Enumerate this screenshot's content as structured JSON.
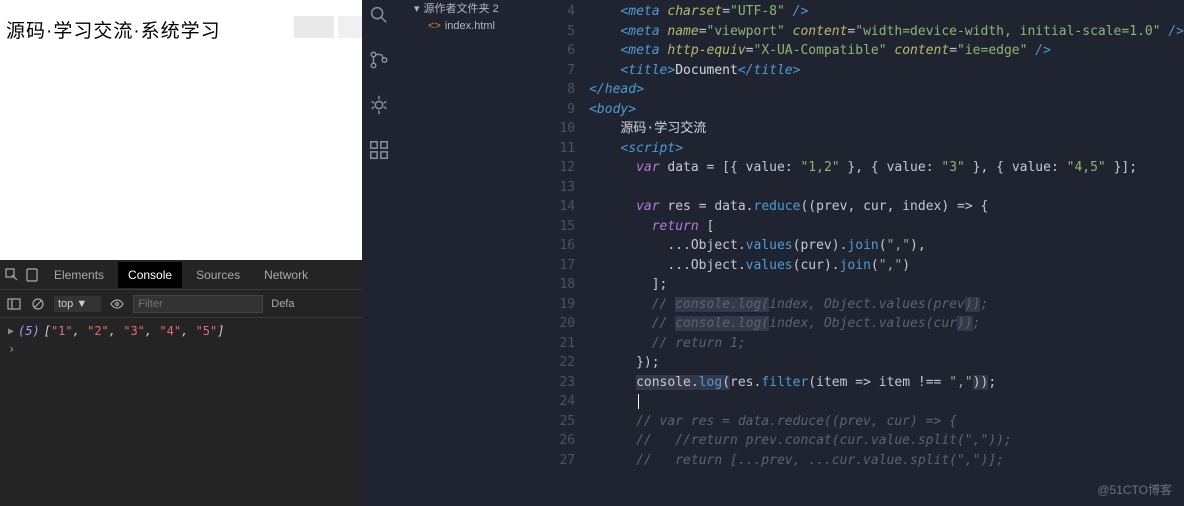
{
  "browser": {
    "title": "源码·学习交流·系统学习"
  },
  "devtools": {
    "tabs": [
      "Elements",
      "Console",
      "Sources",
      "Network"
    ],
    "active_tab": "Console",
    "context": "top",
    "filter_placeholder": "Filter",
    "levels": "Defa",
    "output": {
      "count": "(5)",
      "items": [
        "\"1\"",
        "\"2\"",
        "\"3\"",
        "\"4\"",
        "\"5\""
      ]
    }
  },
  "explorer": {
    "folder": "源作者文件夹 2",
    "file": "index.html"
  },
  "editor": {
    "first_line": 4,
    "lines": [
      {
        "n": 4,
        "html": "    <span class='tag'>&lt;meta</span> <span class='attr'>charset</span><span class='op'>=</span><span class='str'>\"UTF-8\"</span> <span class='tag'>/&gt;</span>"
      },
      {
        "n": 5,
        "html": "    <span class='tag'>&lt;meta</span> <span class='attr'>name</span><span class='op'>=</span><span class='str'>\"viewport\"</span> <span class='attr'>content</span><span class='op'>=</span><span class='str'>\"width=device-width, initial-scale=1.0\"</span> <span class='tag'>/&gt;</span>"
      },
      {
        "n": 6,
        "html": "    <span class='tag'>&lt;meta</span> <span class='attr'>http-equiv</span><span class='op'>=</span><span class='str'>\"X-UA-Compatible\"</span> <span class='attr'>content</span><span class='op'>=</span><span class='str'>\"ie=edge\"</span> <span class='tag'>/&gt;</span>"
      },
      {
        "n": 7,
        "html": "    <span class='tag'>&lt;title&gt;</span><span class='txt'>Document</span><span class='tag'>&lt;/title&gt;</span>"
      },
      {
        "n": 8,
        "html": "<span class='tag'>&lt;/head&gt;</span>"
      },
      {
        "n": 9,
        "html": "<span class='tag'>&lt;body&gt;</span>"
      },
      {
        "n": 10,
        "html": "    <span class='txt'>源码·学习交流</span>"
      },
      {
        "n": 11,
        "html": "    <span class='tag'>&lt;script&gt;</span>"
      },
      {
        "n": 12,
        "html": "      <span class='kw'>var</span> <span class='var'>data</span> <span class='op'>=</span> [{ <span class='var'>value</span>: <span class='strlit'>\"1,2\"</span> }, { <span class='var'>value</span>: <span class='strlit'>\"3\"</span> }, { <span class='var'>value</span>: <span class='strlit'>\"4,5\"</span> }];"
      },
      {
        "n": 13,
        "html": ""
      },
      {
        "n": 14,
        "html": "      <span class='kw'>var</span> <span class='var'>res</span> <span class='op'>=</span> <span class='var'>data</span>.<span class='fn'>reduce</span>((<span class='var'>prev</span>, <span class='var'>cur</span>, <span class='var'>index</span>) <span class='op'>=&gt;</span> {"
      },
      {
        "n": 15,
        "html": "        <span class='kw'>return</span> ["
      },
      {
        "n": 16,
        "html": "          ...<span class='var'>Object</span>.<span class='fn'>values</span>(<span class='var'>prev</span>).<span class='fn'>join</span>(<span class='strlit'>\",\"</span>),"
      },
      {
        "n": 17,
        "html": "          ...<span class='var'>Object</span>.<span class='fn'>values</span>(<span class='var'>cur</span>).<span class='fn'>join</span>(<span class='strlit'>\",\"</span>)"
      },
      {
        "n": 18,
        "html": "        ];"
      },
      {
        "n": 19,
        "html": "        <span class='cm'>// <span class='hl'>console.log(</span>index, Object.values(prev<span class='hl'>))</span>;</span>"
      },
      {
        "n": 20,
        "html": "        <span class='cm'>// <span class='hl'>console.log(</span>index, Object.values(cur<span class='hl'>))</span>;</span>"
      },
      {
        "n": 21,
        "html": "        <span class='cm'>// return 1;</span>"
      },
      {
        "n": 22,
        "html": "      });"
      },
      {
        "n": 23,
        "html": "      <span class='hl'><span class='var'>console</span>.<span class='fn'>log</span>(</span><span class='var'>res</span>.<span class='fn'>filter</span>(<span class='var'>item</span> <span class='op'>=&gt;</span> <span class='var'>item</span> <span class='op'>!==</span> <span class='strlit'>\",\"</span><span class='hl'>))</span>;"
      },
      {
        "n": 24,
        "html": "      <span class='cursor-caret'></span>"
      },
      {
        "n": 25,
        "html": "      <span class='cm'>// var res = data.reduce((prev, cur) =&gt; {</span>"
      },
      {
        "n": 26,
        "html": "      <span class='cm'>//   //return prev.concat(cur.value.split(\",\"));</span>"
      },
      {
        "n": 27,
        "html": "      <span class='cm'>//   return [...prev, ...cur.value.split(\",\")];</span>"
      }
    ]
  },
  "watermark": "@51CTO博客"
}
